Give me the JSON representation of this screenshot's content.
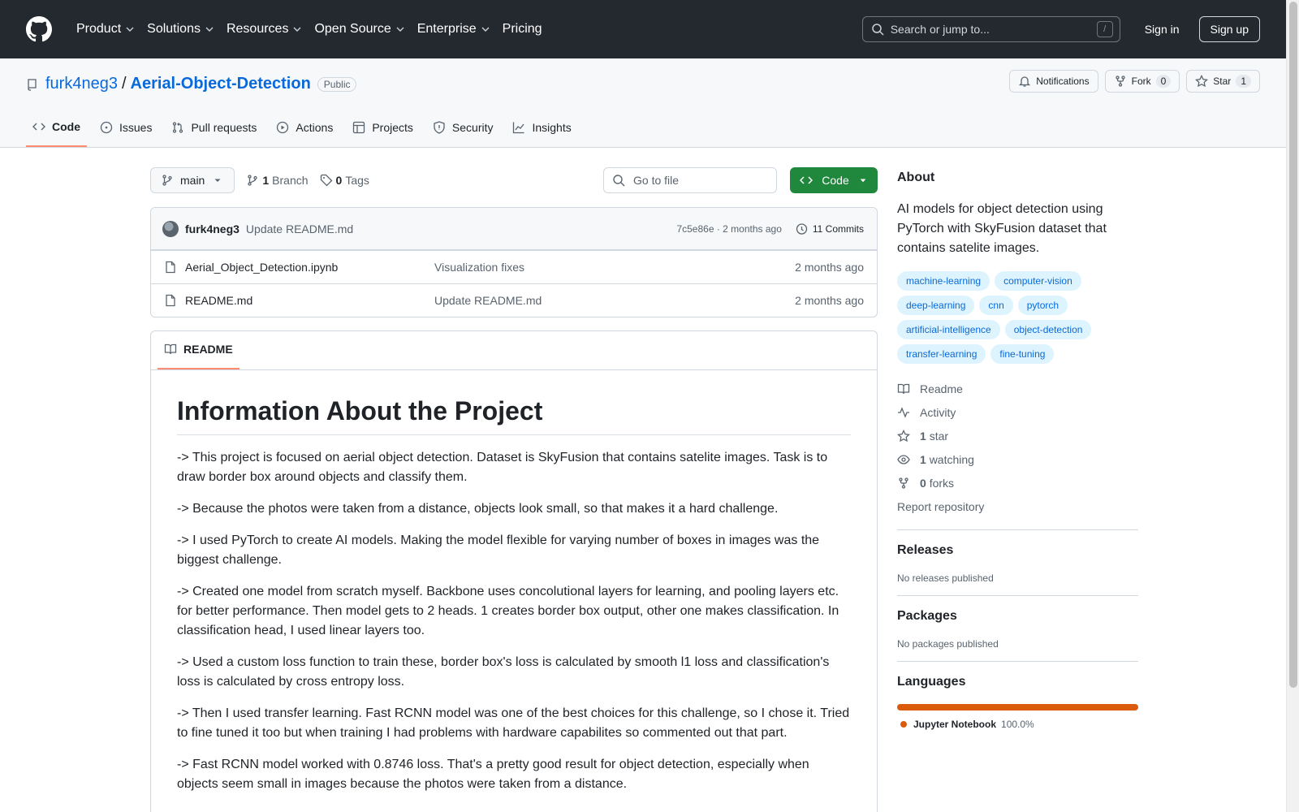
{
  "header": {
    "nav": [
      "Product",
      "Solutions",
      "Resources",
      "Open Source",
      "Enterprise",
      "Pricing"
    ],
    "search_placeholder": "Search or jump to...",
    "search_kbd": "/",
    "sign_in": "Sign in",
    "sign_up": "Sign up"
  },
  "repo": {
    "owner": "furk4neg3",
    "name": "Aerial-Object-Detection",
    "visibility": "Public",
    "notifications": "Notifications",
    "fork_label": "Fork",
    "fork_count": "0",
    "star_label": "Star",
    "star_count": "1"
  },
  "tabs": [
    "Code",
    "Issues",
    "Pull requests",
    "Actions",
    "Projects",
    "Security",
    "Insights"
  ],
  "toolbar": {
    "branch": "main",
    "branch_count": "1",
    "branch_label": "Branch",
    "tag_count": "0",
    "tag_label": "Tags",
    "goto_placeholder": "Go to file",
    "code_button": "Code"
  },
  "commit": {
    "author": "furk4neg3",
    "message": "Update README.md",
    "hash_time": "7c5e86e · 2 months ago",
    "commits": "11 Commits"
  },
  "files": [
    {
      "name": "Aerial_Object_Detection.ipynb",
      "message": "Visualization fixes",
      "time": "2 months ago"
    },
    {
      "name": "README.md",
      "message": "Update README.md",
      "time": "2 months ago"
    }
  ],
  "readme": {
    "tab": "README",
    "title": "Information About the Project",
    "paragraphs": [
      "-> This project is focused on aerial object detection. Dataset is SkyFusion that contains satelite images. Task is to draw border box around objects and classify them.",
      "-> Because the photos were taken from a distance, objects look small, so that makes it a hard challenge.",
      "-> I used PyTorch to create AI models. Making the model flexible for varying number of boxes in images was the biggest challenge.",
      "-> Created one model from scratch myself. Backbone uses concolutional layers for learning, and pooling layers etc. for better performance. Then model gets to 2 heads. 1 creates border box output, other one makes classification. In classification head, I used linear layers too.",
      "-> Used a custom loss function to train these, border box's loss is calculated by smooth l1 loss and classification's loss is calculated by cross entropy loss.",
      "-> Then I used transfer learning. Fast RCNN model was one of the best choices for this challenge, so I chose it. Tried to fine tuned it too but when training I had problems with hardware capabilites so commented out that part.",
      "-> Fast RCNN model worked with 0.8746 loss. That's a pretty good result for object detection, especially when objects seem small in images because the photos were taken from a distance."
    ]
  },
  "sidebar": {
    "about_title": "About",
    "description": "AI models for object detection using PyTorch with SkyFusion dataset that contains satelite images.",
    "topics": [
      "machine-learning",
      "computer-vision",
      "deep-learning",
      "cnn",
      "pytorch",
      "artificial-intelligence",
      "object-detection",
      "transfer-learning",
      "fine-tuning"
    ],
    "readme_link": "Readme",
    "activity_link": "Activity",
    "stars_count": "1",
    "stars_label": "star",
    "watching_count": "1",
    "watching_label": "watching",
    "forks_count": "0",
    "forks_label": "forks",
    "report": "Report repository",
    "releases_title": "Releases",
    "releases_note": "No releases published",
    "packages_title": "Packages",
    "packages_note": "No packages published",
    "languages_title": "Languages",
    "language_name": "Jupyter Notebook",
    "language_pct": "100.0%",
    "language_color": "#da5b0b"
  }
}
